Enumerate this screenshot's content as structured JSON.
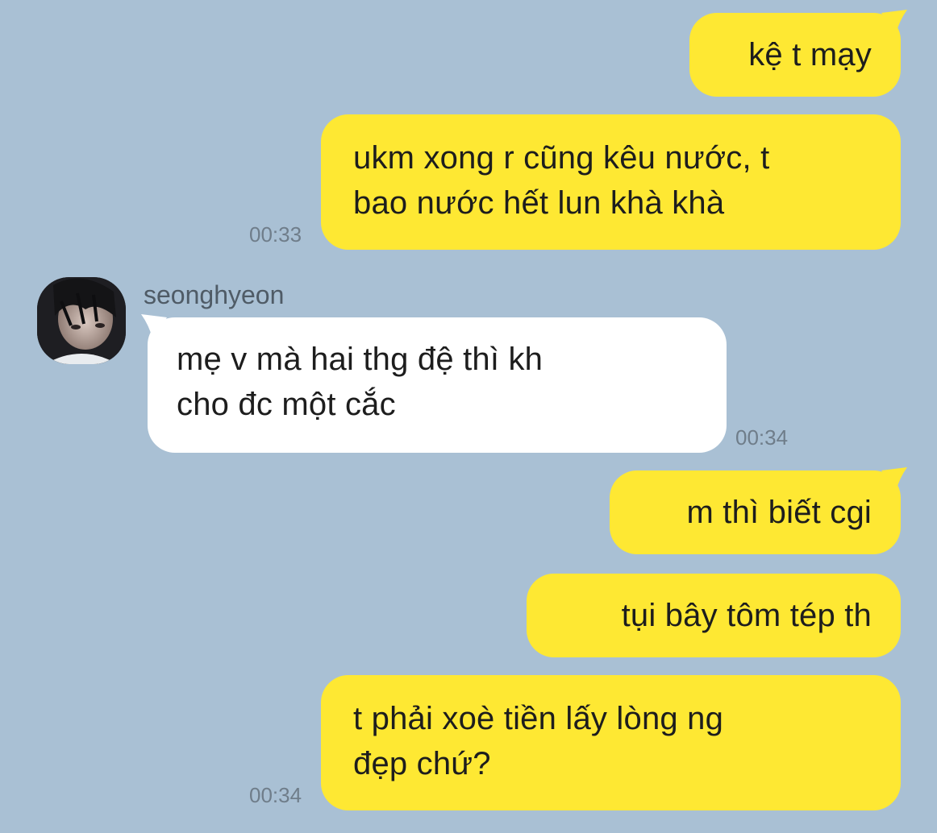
{
  "messages": [
    {
      "id": "m1",
      "direction": "outgoing",
      "lines": [
        "kệ t mạy"
      ],
      "time": ""
    },
    {
      "id": "m2",
      "direction": "outgoing",
      "lines": [
        "ukm xong r cũng kêu nước, t",
        "bao nước hết lun khà khà"
      ],
      "time": "00:33"
    },
    {
      "id": "m3",
      "direction": "incoming",
      "sender": "seonghyeon",
      "lines": [
        "mẹ  v  mà  hai  thg  đệ  thì  kh",
        "cho đc một cắc"
      ],
      "time": "00:34"
    },
    {
      "id": "m4",
      "direction": "outgoing",
      "lines": [
        "m thì biết cgi"
      ],
      "time": ""
    },
    {
      "id": "m5",
      "direction": "outgoing",
      "lines": [
        "tụi bây tôm tép th"
      ],
      "time": ""
    },
    {
      "id": "m6",
      "direction": "outgoing",
      "lines": [
        "t  phải  xoè  tiền  lấy  lòng  ng",
        "đẹp chứ?"
      ],
      "time": "00:34"
    }
  ],
  "colors": {
    "background": "#a9c0d4",
    "outgoing_bubble": "#fee833",
    "incoming_bubble": "#ffffff"
  }
}
